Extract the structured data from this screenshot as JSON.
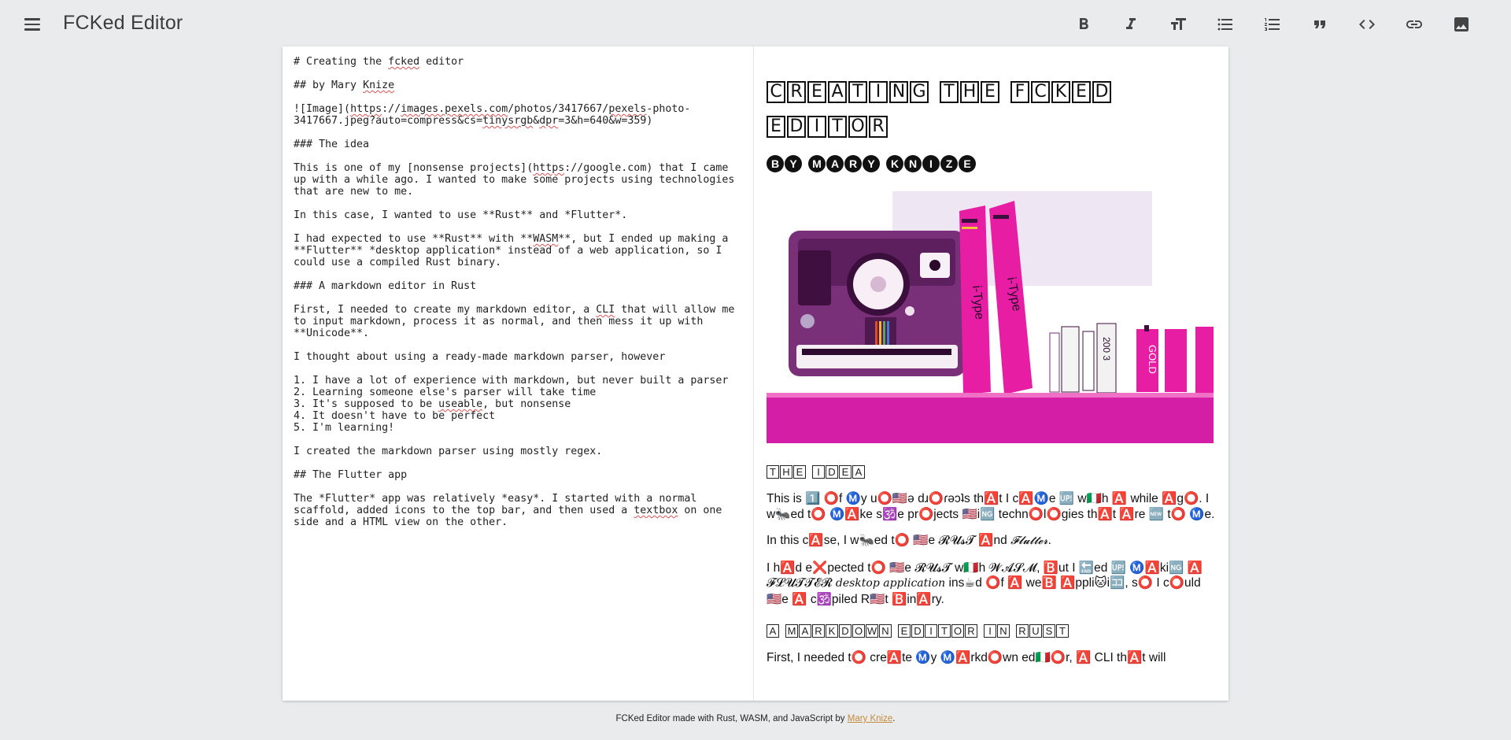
{
  "app": {
    "title": "FCKed Editor"
  },
  "toolbar": {
    "buttons": [
      {
        "name": "bold",
        "icon": "bold-icon"
      },
      {
        "name": "italic",
        "icon": "italic-icon"
      },
      {
        "name": "heading",
        "icon": "text-size-icon"
      },
      {
        "name": "bulleted-list",
        "icon": "bulleted-list-icon"
      },
      {
        "name": "numbered-list",
        "icon": "numbered-list-icon"
      },
      {
        "name": "quote",
        "icon": "quote-icon"
      },
      {
        "name": "code",
        "icon": "code-icon"
      },
      {
        "name": "link",
        "icon": "link-icon"
      },
      {
        "name": "image",
        "icon": "image-icon"
      }
    ]
  },
  "source": {
    "lines": [
      "# Creating the fcked editor",
      "",
      "## by Mary Knize",
      "",
      "![Image](https://images.pexels.com/photos/3417667/pexels-photo-",
      "3417667.jpeg?auto=compress&cs=tinysrgb&dpr=3&h=640&w=359)",
      "",
      "### The idea",
      "",
      "This is one of my [nonsense projects](https://google.com) that I came",
      "up with a while ago. I wanted to make some projects using technologies",
      "that are new to me.",
      "",
      "In this case, I wanted to use **Rust** and *Flutter*.",
      "",
      "I had expected to use **Rust** with **WASM**, but I ended up making a",
      "**Flutter** *desktop application* instead of a web application, so I",
      "could use a compiled Rust binary.",
      "",
      "### A markdown editor in Rust",
      "",
      "First, I needed to create my markdown editor, a CLI that will allow me",
      "to input markdown, process it as normal, and then mess it up with",
      "**Unicode**.",
      "",
      "I thought about using a ready-made markdown parser, however",
      "",
      "1. I have a lot of experience with markdown, but never built a parser",
      "2. Learning someone else's parser will take time",
      "3. It's supposed to be useable, but nonsense",
      "4. It doesn't have to be perfect",
      "5. I'm learning!",
      "",
      "I created the markdown parser using mostly regex.",
      "",
      "## The Flutter app",
      "",
      "The *Flutter* app was relatively *easy*. I started with a normal",
      "scaffold, added icons to the top bar, and then used a textbox on one",
      "side and a HTML view on the other."
    ],
    "misspelled": [
      "fcked",
      "Knize",
      "images.pexels.com",
      "pexels",
      "tinysrgb",
      "dpr",
      "https",
      "WASM",
      "CLI",
      "useable",
      "textbox"
    ]
  },
  "preview": {
    "h1_words": [
      "CREATING",
      "THE",
      "FCKED",
      "EDITOR"
    ],
    "h2_words": [
      "BY",
      "MARY",
      "KNIZE"
    ],
    "h3_idea": [
      "THE",
      "IDEA"
    ],
    "h3_markdown": [
      "A",
      "MARKDOWN",
      "EDITOR",
      "IN",
      "RUST"
    ],
    "para1": "This is 1️⃣ ⭕f Ⓜ️y u⭕🇺🇸ə dɹ⭕ɾǝɔʇs th🅰️t I c🅰️Ⓜ️e 🆙 w🇮🇹h 🅰️ while 🅰️g⭕. I w🐜ed t⭕ Ⓜ️🅰️ke s🕉️e pr⭕jects 🇺🇸i🆖 techn⭕l⭕gies th🅰️t 🅰️re 🆕 t⭕ Ⓜ️e.",
    "para2_prefix": "In this c🅰️se, I w🐜ed t⭕ 🇺🇸e 𝓡𝓤𝓼𝓣 🅰️nd ",
    "para2_italic": "𝓕𝓵𝓾𝓽𝓽𝓮𝓻",
    "para2_suffix": ".",
    "para3_prefix": "I h🅰️d e❌pected t⭕ 🇺🇸e 𝓡𝓤𝓼𝓣 w🇮🇹h 𝓦𝓐𝓢𝓜, 🅱️ut I 🔚ed 🆙 Ⓜ️🅰️ki🆖 🅰️ 𝓕𝓛𝓤𝓣𝓣𝓔𝓡 ",
    "para3_italic": "desktop application",
    "para3_suffix": " ins☕d ⭕f 🅰️ we🅱️ 🅰️ppli🐱i🈁, s⭕ I c⭕uld 🇺🇸e 🅰️ c🕉️piled R🇺🇸t 🅱️in🅰️ry.",
    "para4": "First, I needed t⭕ cre🅰️te Ⓜ️y Ⓜ️🅰️rkd⭕wn ed🇮🇹⭕r, 🅰️ CLI th🅰️t will"
  },
  "footer": {
    "text": "FCKed Editor made with Rust, WASM, and JavaScript by ",
    "author": "Mary Knize",
    "end": "."
  },
  "colors": {
    "background": "#e9ebec",
    "card": "#ffffff",
    "footer_link": "#c58b3d"
  }
}
